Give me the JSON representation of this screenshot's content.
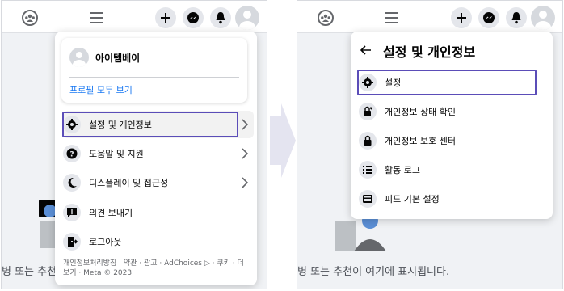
{
  "left_panel": {
    "bg_text": "병 또는 추천",
    "profile": {
      "name": "아이템베이",
      "see_all": "프로필 모두 보기"
    },
    "menu": [
      {
        "label": "설정 및 개인정보",
        "icon": "gear-icon",
        "chevron": true
      },
      {
        "label": "도움말 및 지원",
        "icon": "question-icon",
        "chevron": true
      },
      {
        "label": "디스플레이 및 접근성",
        "icon": "moon-icon",
        "chevron": true
      },
      {
        "label": "의견 보내기",
        "icon": "feedback-icon",
        "chevron": false
      },
      {
        "label": "로그아웃",
        "icon": "logout-icon",
        "chevron": false
      }
    ],
    "footer": "개인정보처리방침 · 약관 · 광고 · AdChoices ▷ · 쿠키 · 더 보기 · Meta © 2023"
  },
  "right_panel": {
    "bg_text": "병 또는 추천이 여기에 표시됩니다.",
    "title": "설정 및 개인정보",
    "menu": [
      {
        "label": "설정",
        "icon": "gear-icon"
      },
      {
        "label": "개인정보 상태 확인",
        "icon": "lock-heart-icon"
      },
      {
        "label": "개인정보 보호 센터",
        "icon": "lock-icon"
      },
      {
        "label": "활동 로그",
        "icon": "list-icon"
      },
      {
        "label": "피드 기본 설정",
        "icon": "feed-icon"
      }
    ]
  },
  "colors": {
    "highlight": "#5b4db8",
    "link": "#1877f2",
    "icon_bg": "#e4e6eb"
  }
}
